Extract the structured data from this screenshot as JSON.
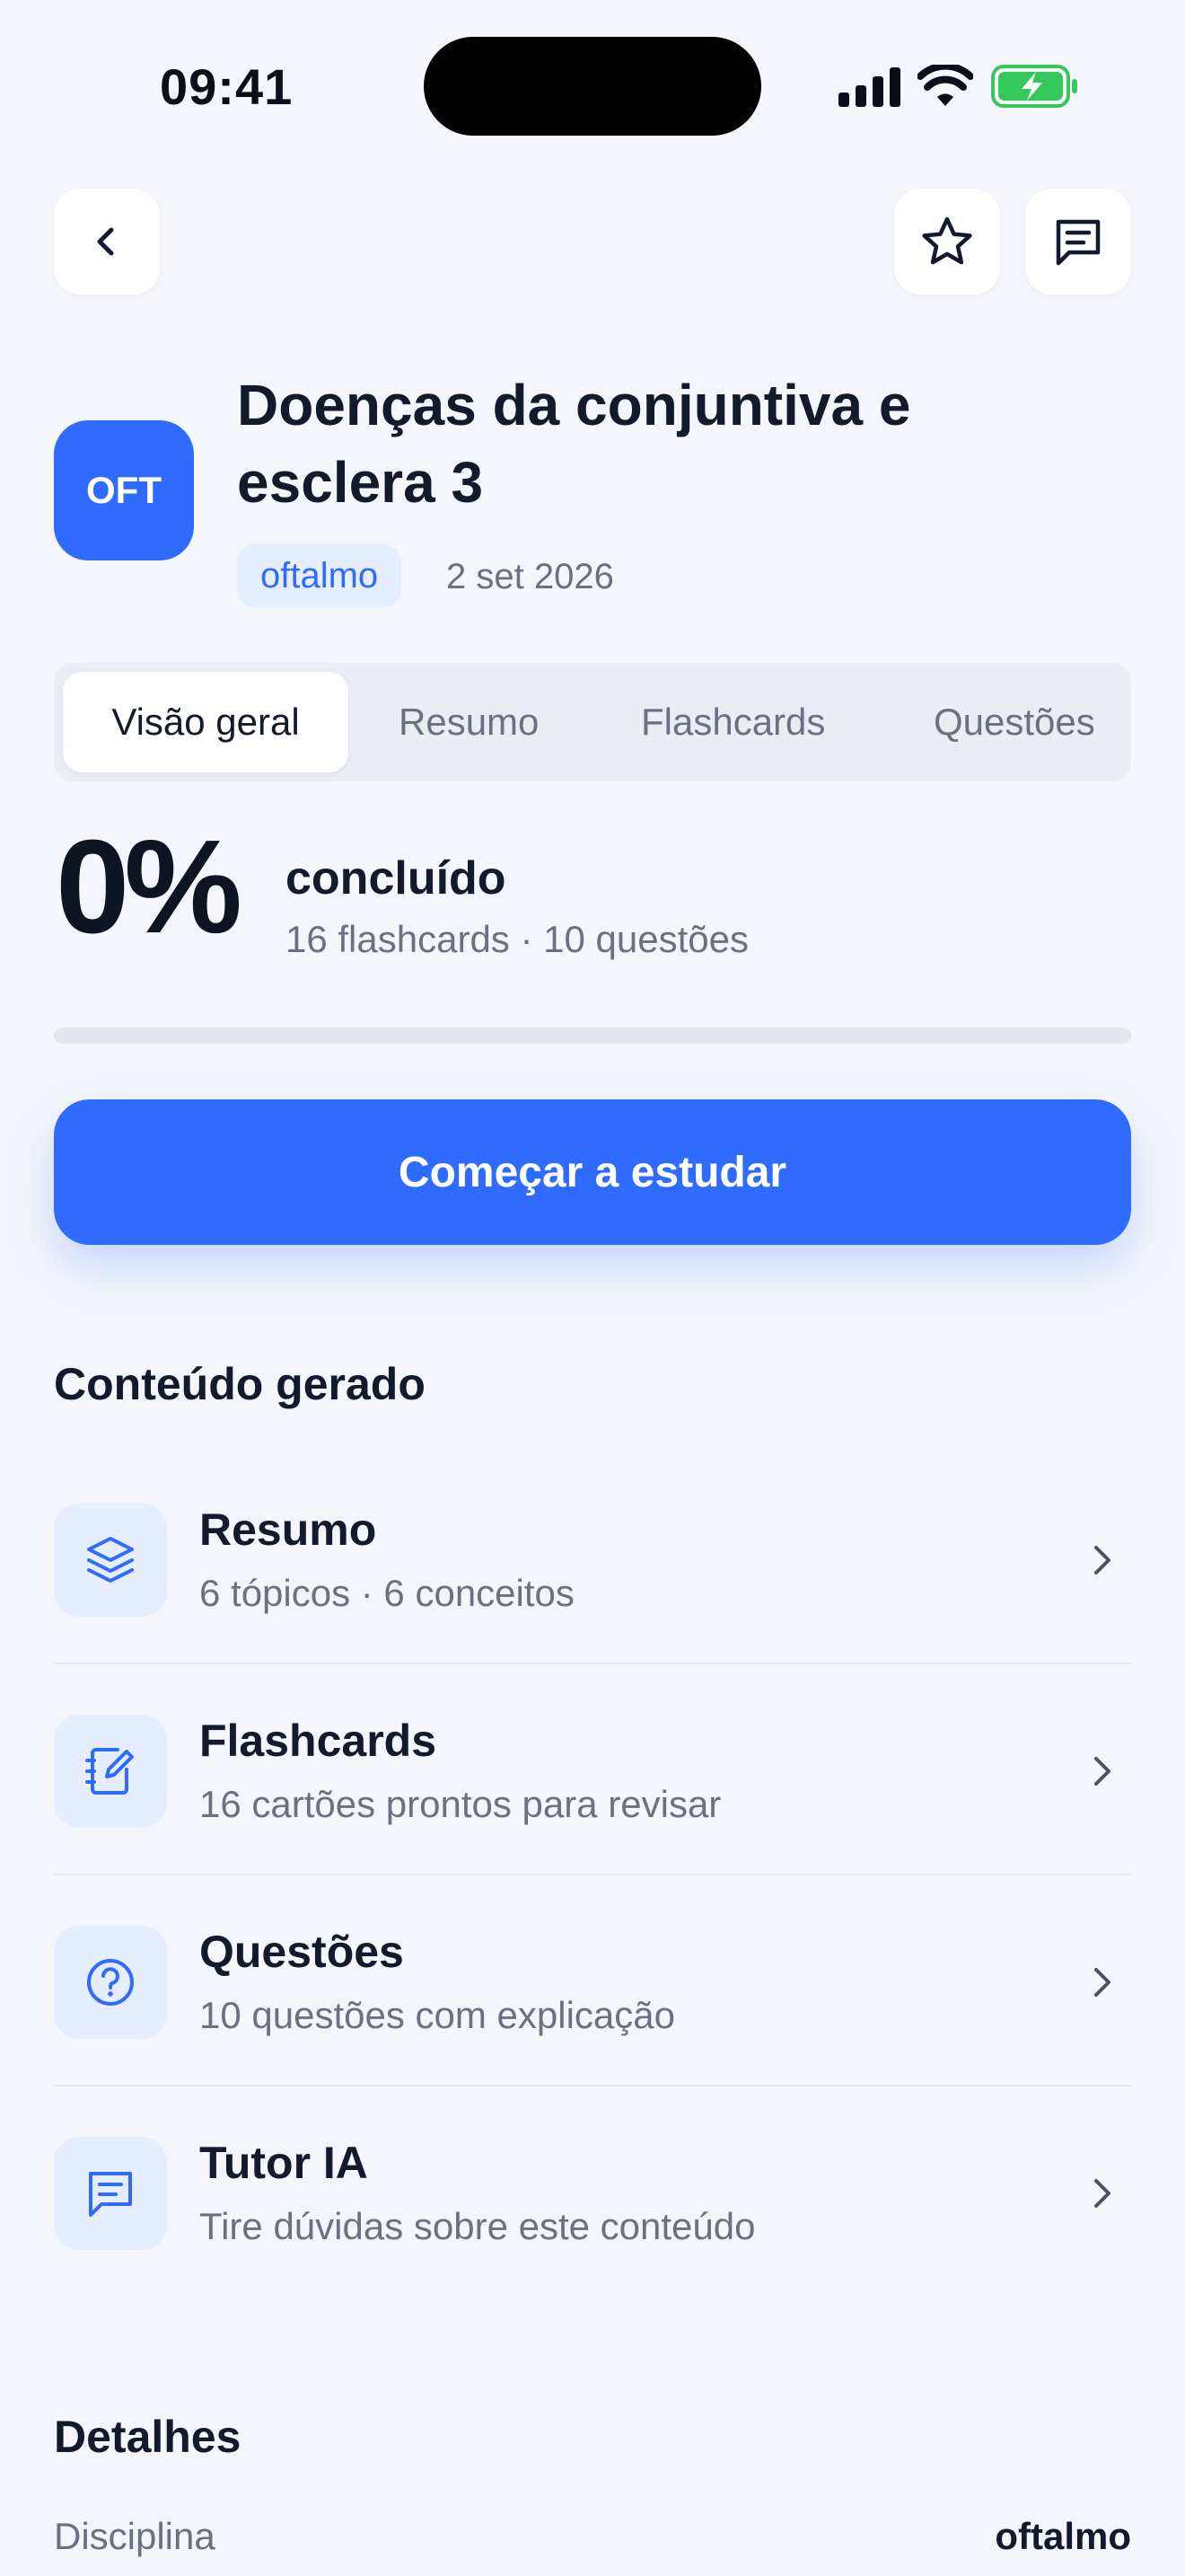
{
  "status_bar": {
    "time": "09:41"
  },
  "nav": {
    "back_icon": "chevron-left-icon",
    "favorite_icon": "star-icon",
    "notes_icon": "message-icon"
  },
  "header": {
    "badge": "OFT",
    "title": "Doenças da conjuntiva e esclera 3",
    "tag": "oftalmo",
    "date": "2 set 2026"
  },
  "tabs": [
    {
      "label": "Visão geral",
      "active": true
    },
    {
      "label": "Resumo",
      "active": false
    },
    {
      "label": "Flashcards",
      "active": false
    },
    {
      "label": "Questões",
      "active": false
    }
  ],
  "progress": {
    "percent_label": "0%",
    "value": 0,
    "label": "concluído",
    "subtitle": "16 flashcards · 10 questões"
  },
  "cta": {
    "label": "Começar a estudar"
  },
  "content": {
    "title": "Conteúdo gerado",
    "items": [
      {
        "icon": "layers-icon",
        "title": "Resumo",
        "subtitle": "6 tópicos · 6 conceitos"
      },
      {
        "icon": "notebook-pen-icon",
        "title": "Flashcards",
        "subtitle": "16 cartões prontos para revisar"
      },
      {
        "icon": "question-circle-icon",
        "title": "Questões",
        "subtitle": "10 questões com explicação"
      },
      {
        "icon": "message-icon",
        "title": "Tutor IA",
        "subtitle": "Tire dúvidas sobre este conteúdo"
      }
    ]
  },
  "details": {
    "title": "Detalhes",
    "rows": [
      {
        "label": "Disciplina",
        "value": "oftalmo"
      }
    ]
  },
  "colors": {
    "accent": "#2f6bff",
    "accent_soft": "#e6edff",
    "background": "#f4f6fb",
    "battery": "#34c759"
  }
}
